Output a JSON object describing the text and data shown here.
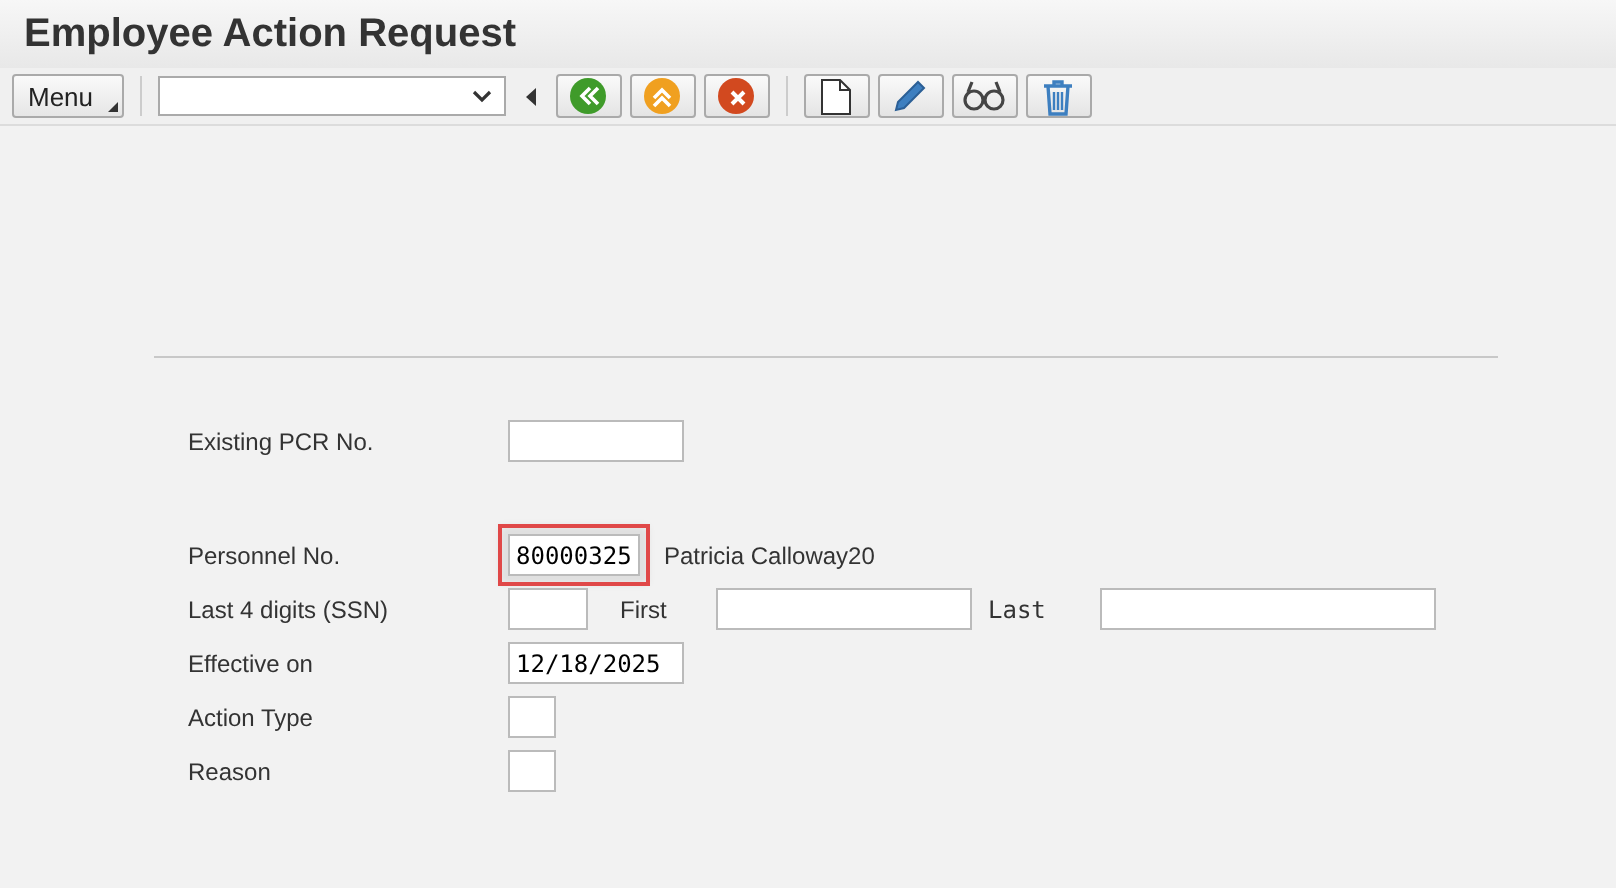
{
  "window": {
    "title": "Employee Action Request"
  },
  "toolbar": {
    "menu": "Menu",
    "buttons": [
      {
        "kind": "back"
      },
      {
        "kind": "up"
      },
      {
        "kind": "cancel"
      },
      {
        "kind": "document"
      },
      {
        "kind": "edit"
      },
      {
        "kind": "display"
      },
      {
        "kind": "delete"
      }
    ]
  },
  "form": {
    "existing_pcr": {
      "label": "Existing PCR No."
    },
    "personnel": {
      "label": "Personnel No.",
      "value": "80000325",
      "highlighted": true,
      "name": "Patricia Calloway20"
    },
    "ssn": {
      "label": "Last 4 digits (SSN)",
      "first_label": "First",
      "last_label": "Last"
    },
    "effective": {
      "label": "Effective on",
      "value": "12/18/2025"
    },
    "action_type": {
      "label": "Action Type"
    },
    "reason": {
      "label": "Reason"
    }
  }
}
